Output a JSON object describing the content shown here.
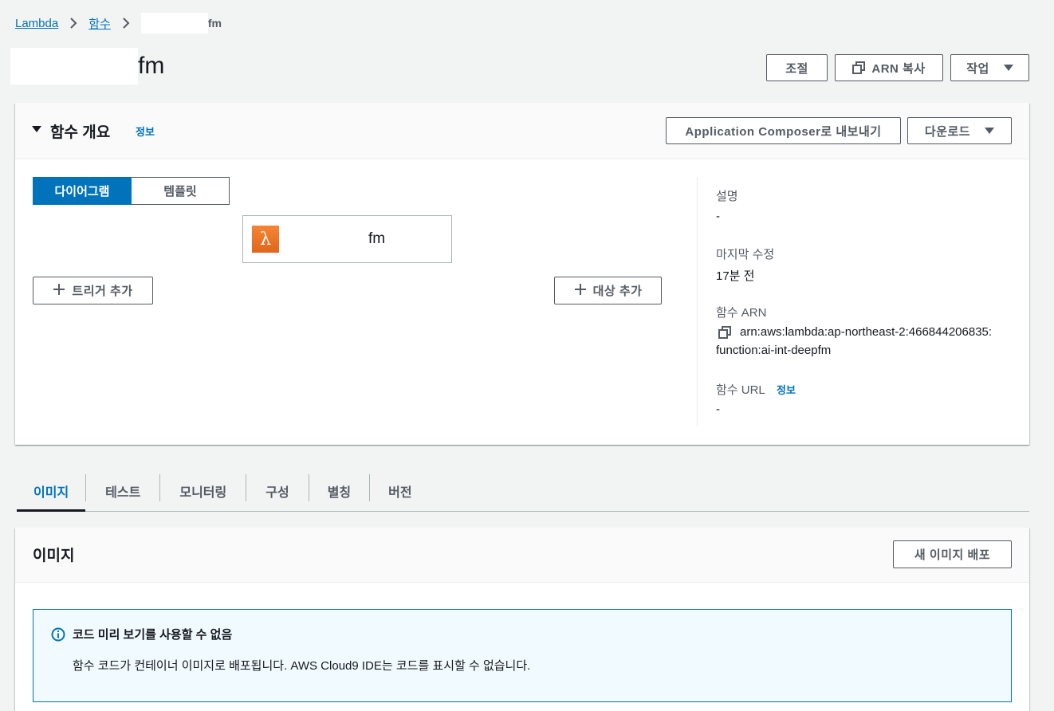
{
  "breadcrumb": {
    "items": [
      "Lambda",
      "함수"
    ],
    "current_suffix": "fm"
  },
  "page": {
    "title_suffix": "fm"
  },
  "header_actions": {
    "throttle": "조절",
    "copy_arn": "ARN 복사",
    "actions": "작업"
  },
  "overview": {
    "title": "함수 개요",
    "info": "정보",
    "export_btn": "Application Composer로 내보내기",
    "download_btn": "다운로드",
    "view_toggle": [
      "다이어그램",
      "템플릿"
    ],
    "function_suffix": "fm",
    "add_trigger": "트리거 추가",
    "add_destination": "대상 추가",
    "details": {
      "description_label": "설명",
      "description_value": "-",
      "last_modified_label": "마지막 수정",
      "last_modified_value": "17분 전",
      "arn_label": "함수 ARN",
      "arn_value_line1": "arn:aws:lambda:ap-northeast-2:466844206835:",
      "arn_value_line2": "function:ai-int-deepfm",
      "url_label": "함수 URL",
      "url_info": "정보",
      "url_value": "-"
    }
  },
  "tabs": [
    "이미지",
    "테스트",
    "모니터링",
    "구성",
    "별칭",
    "버전"
  ],
  "image_section": {
    "title": "이미지",
    "deploy_btn": "새 이미지 배포",
    "alert_title": "코드 미리 보기를 사용할 수 없음",
    "alert_body": "함수 코드가 컨테이너 이미지로 배포됩니다. AWS Cloud9 IDE는 코드를 표시할 수 없습니다."
  },
  "colors": {
    "accent": "#0073bb",
    "lambda_orange": "#e8701e",
    "background": "#f2f3f3"
  }
}
